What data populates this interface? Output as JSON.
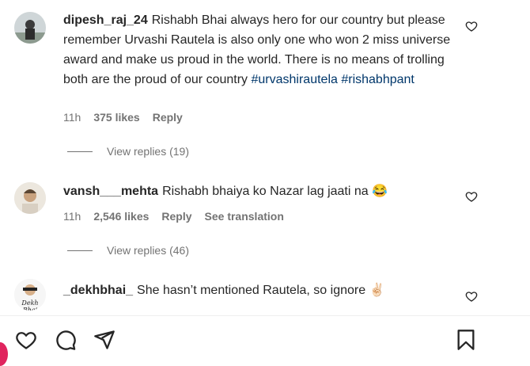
{
  "comments": [
    {
      "username": "dipesh_raj_24",
      "text": "Rishabh Bhai always hero for our country but please remember Urvashi Rautela is also only one who won 2 miss universe award and make us proud in the world. There is no means of trolling both are the proud of our country",
      "hashtags": "#urvashirautela #rishabhpant",
      "time": "11h",
      "likes": "375 likes",
      "reply": "Reply",
      "view_replies": "View replies (19)"
    },
    {
      "username": "vansh___mehta",
      "text": "Rishabh bhaiya ko Nazar lag jaati na",
      "emoji": "😂",
      "time": "11h",
      "likes": "2,546 likes",
      "reply": "Reply",
      "see_translation": "See translation",
      "view_replies": "View replies (46)"
    },
    {
      "username": "_dekhbhai_",
      "text": "She hasn’t mentioned Rautela, so ignore",
      "emoji": "✌🏻",
      "avatar_text": "Dekh Bhai"
    }
  ],
  "icons": {
    "like": "heart-icon",
    "comment": "comment-icon",
    "share": "share-icon",
    "save": "bookmark-icon"
  }
}
